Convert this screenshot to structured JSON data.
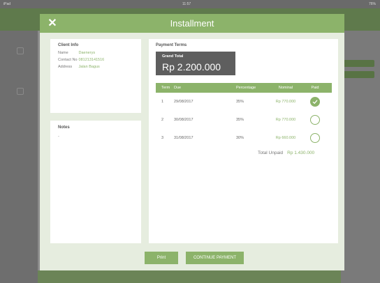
{
  "status_bar": {
    "carrier": "iPad",
    "time": "11:57",
    "battery": "76%"
  },
  "modal": {
    "title": "Installment",
    "close_icon": "close-icon"
  },
  "client_info": {
    "heading": "Client Info",
    "rows": [
      {
        "label": "Name",
        "value": "Daenerys"
      },
      {
        "label": "Contact No",
        "value": "081213141516"
      },
      {
        "label": "Address",
        "value": "Jalan Bagus"
      }
    ]
  },
  "notes": {
    "heading": "Notes",
    "value": "-"
  },
  "payment_terms": {
    "heading": "Payment Terms",
    "grand_total_label": "Grand Total",
    "grand_total_value": "Rp 2.200.000",
    "columns": {
      "term": "Term",
      "due": "Due",
      "percentage": "Percentage",
      "nominal": "Nominal",
      "paid": "Paid"
    },
    "rows": [
      {
        "term": "1",
        "due": "29/08/2017",
        "percentage": "35%",
        "nominal": "Rp 770.000",
        "paid": true
      },
      {
        "term": "2",
        "due": "30/08/2017",
        "percentage": "35%",
        "nominal": "Rp 770.000",
        "paid": false
      },
      {
        "term": "3",
        "due": "31/08/2017",
        "percentage": "30%",
        "nominal": "Rp 660.000",
        "paid": false
      }
    ],
    "total_unpaid_label": "Total Unpaid",
    "total_unpaid_value": "Rp 1.430.000"
  },
  "buttons": {
    "print": "Print",
    "continue": "CONTINUE PAYMENT"
  },
  "colors": {
    "accent": "#8cb36a",
    "grand_total_bg": "#5e5e5e",
    "modal_bg": "#e6eddf"
  }
}
